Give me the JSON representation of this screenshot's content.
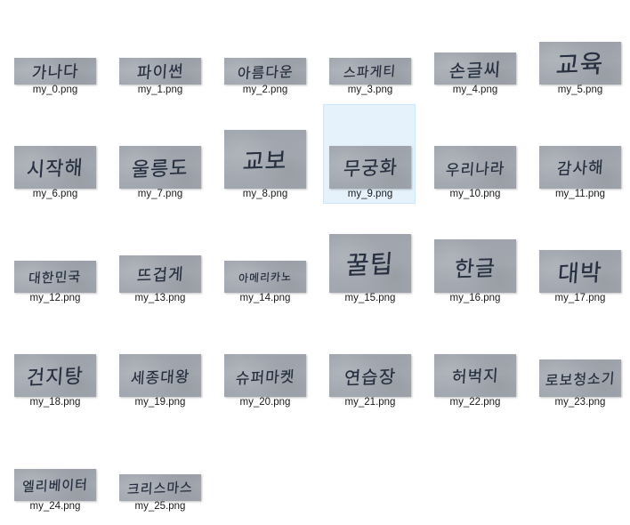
{
  "files": [
    {
      "name": "my_0.png",
      "thumb_text": "가나다",
      "selected": false
    },
    {
      "name": "my_1.png",
      "thumb_text": "파이썬",
      "selected": false
    },
    {
      "name": "my_2.png",
      "thumb_text": "아름다운",
      "selected": false
    },
    {
      "name": "my_3.png",
      "thumb_text": "스파게티",
      "selected": false
    },
    {
      "name": "my_4.png",
      "thumb_text": "손글씨",
      "selected": false
    },
    {
      "name": "my_5.png",
      "thumb_text": "교육",
      "selected": false
    },
    {
      "name": "my_6.png",
      "thumb_text": "시작해",
      "selected": false
    },
    {
      "name": "my_7.png",
      "thumb_text": "울릉도",
      "selected": false
    },
    {
      "name": "my_8.png",
      "thumb_text": "교보",
      "selected": false
    },
    {
      "name": "my_9.png",
      "thumb_text": "무궁화",
      "selected": true
    },
    {
      "name": "my_10.png",
      "thumb_text": "우리나라",
      "selected": false
    },
    {
      "name": "my_11.png",
      "thumb_text": "감사해",
      "selected": false
    },
    {
      "name": "my_12.png",
      "thumb_text": "대한민국",
      "selected": false
    },
    {
      "name": "my_13.png",
      "thumb_text": "뜨겁게",
      "selected": false
    },
    {
      "name": "my_14.png",
      "thumb_text": "아메리카노",
      "selected": false
    },
    {
      "name": "my_15.png",
      "thumb_text": "꿀팁",
      "selected": false
    },
    {
      "name": "my_16.png",
      "thumb_text": "한글",
      "selected": false
    },
    {
      "name": "my_17.png",
      "thumb_text": "대박",
      "selected": false
    },
    {
      "name": "my_18.png",
      "thumb_text": "건지탕",
      "selected": false
    },
    {
      "name": "my_19.png",
      "thumb_text": "세종대왕",
      "selected": false
    },
    {
      "name": "my_20.png",
      "thumb_text": "슈퍼마켓",
      "selected": false
    },
    {
      "name": "my_21.png",
      "thumb_text": "연습장",
      "selected": false
    },
    {
      "name": "my_22.png",
      "thumb_text": "허벅지",
      "selected": false
    },
    {
      "name": "my_23.png",
      "thumb_text": "로보청소기",
      "selected": false
    },
    {
      "name": "my_24.png",
      "thumb_text": "엘리베이터",
      "selected": false
    },
    {
      "name": "my_25.png",
      "thumb_text": "크리스마스",
      "selected": false
    }
  ]
}
